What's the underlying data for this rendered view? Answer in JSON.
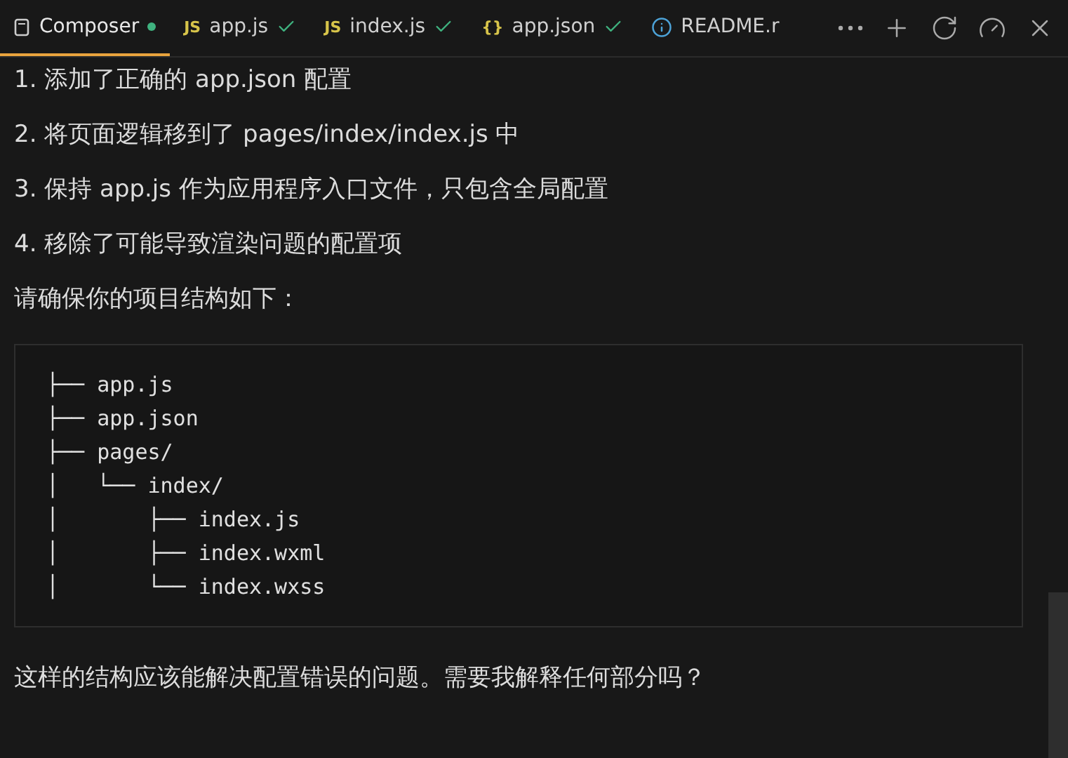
{
  "tabs": [
    {
      "kind": "composer",
      "label": "Composer",
      "selected": true,
      "modified": true,
      "saved": false
    },
    {
      "kind": "js",
      "badge": "JS",
      "label": "app.js",
      "selected": false,
      "modified": false,
      "saved": true
    },
    {
      "kind": "js",
      "badge": "JS",
      "label": "index.js",
      "selected": false,
      "modified": false,
      "saved": true
    },
    {
      "kind": "json",
      "badge": "{}",
      "label": "app.json",
      "selected": false,
      "modified": false,
      "saved": true
    },
    {
      "kind": "info",
      "label": "README.r",
      "selected": false,
      "modified": false,
      "saved": false
    }
  ],
  "list_items": [
    "1. 添加了正确的 app.json 配置",
    "2. 将页面逻辑移到了 pages/index/index.js 中",
    "3. 保持 app.js 作为应用程序入口文件，只包含全局配置",
    "4. 移除了可能导致渲染问题的配置项"
  ],
  "intro": "请确保你的项目结构如下：",
  "code_lines": [
    "├── app.js",
    "├── app.json",
    "├── pages/",
    "│   └── index/",
    "│       ├── index.js",
    "│       ├── index.wxml",
    "│       └── index.wxss"
  ],
  "closing": "这样的结构应该能解决配置错误的问题。需要我解释任何部分吗？"
}
